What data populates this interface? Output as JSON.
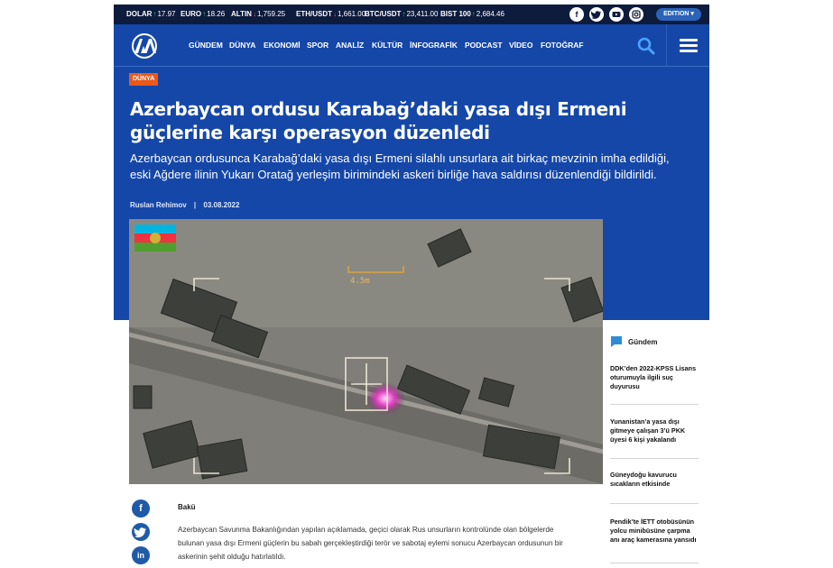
{
  "ticker": [
    {
      "label": "DOLAR",
      "dir": "up",
      "value": "17.97"
    },
    {
      "label": "EURO",
      "dir": "up",
      "value": "18.26"
    },
    {
      "label": "ALTIN",
      "dir": "down",
      "value": "1,759.25"
    },
    {
      "label": "ETH/USDT",
      "dir": "down",
      "value": "1,661.00"
    },
    {
      "label": "BTC/USDT",
      "dir": "up",
      "value": "23,411.00"
    },
    {
      "label": "BIST 100",
      "dir": "up",
      "value": "2,684.46"
    }
  ],
  "colors": {
    "up": "#27c46b",
    "down": "#ff4b4b",
    "header": "#1547a8",
    "topbar": "#0d1b3d",
    "category": "#e8591c"
  },
  "social_top": [
    "facebook-icon",
    "twitter-icon",
    "youtube-icon",
    "instagram-icon"
  ],
  "edition_label": "EDITION",
  "nav": [
    "GÜNDEM",
    "DÜNYA",
    "EKONOMİ",
    "SPOR",
    "ANALİZ",
    "KÜLTÜR",
    "İNFOGRAFİK",
    "PODCAST",
    "VİDEO",
    "FOTOĞRAF"
  ],
  "article": {
    "category": "DÜNYA",
    "title": "Azerbaycan ordusu Karabağ’daki yasa dışı Ermeni güçlerine karşı operasyon düzenledi",
    "summary": "Azerbaycan ordusunca Karabağ’daki yasa dışı Ermeni silahlı unsurlara ait birkaç mevzinin imha edildiği, eski Ağdere ilinin Yukarı Oratağ yerleşim birimindeki askeri birliğe hava saldırısı düzenlendiği bildirildi.",
    "author": "Ruslan Rehimov",
    "date": "03.08.2022",
    "image_overlay": "4.5m",
    "location": "Bakü",
    "body": "Azerbaycan Savunma Bakanlığından yapılan açıklamada, geçici olarak Rus unsurların kontrolünde olan bölgelerde bulunan yasa dışı Ermeni güçlerin bu sabah gerçekleştirdiği terör ve sabotaj eylemi sonucu Azerbaycan ordusunun bir askerinin şehit olduğu hatırlatıldı."
  },
  "share": [
    "facebook-icon",
    "twitter-icon",
    "linkedin-icon"
  ],
  "sidebar": {
    "heading": "Gündem",
    "items": [
      "DDK’den 2022-KPSS Lisans oturumuyla ilgili suç duyurusu",
      "Yunanistan’a yasa dışı gitmeye çalışan 3’ü PKK üyesi 6 kişi yakalandı",
      "Güneydoğu kavurucu sıcakların etkisinde",
      "Pendik’te İETT otobüsünün yolcu minibüsüne çarpma anı araç kamerasına yansıdı"
    ]
  }
}
